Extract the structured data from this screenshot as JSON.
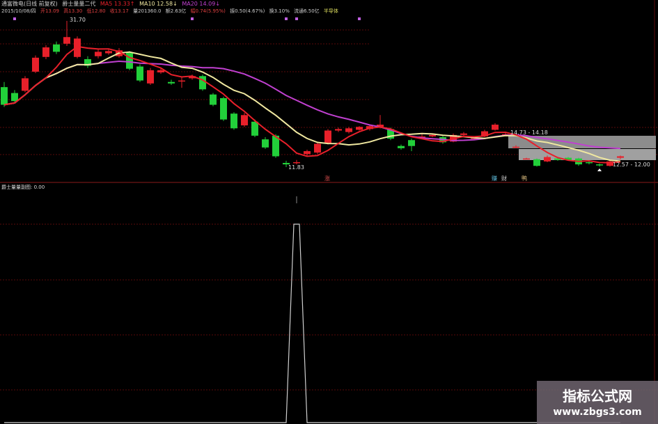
{
  "header": {
    "title": "通富微电(日线 前复权)",
    "indicator": "爵士量量二代",
    "ma5": "MA5 13.33↑",
    "ma10": "MA10 12.58↓",
    "ma20": "MA20 14.09↓",
    "date": "2015/10/08/四",
    "open": "开13.09",
    "high": "高13.30",
    "low": "低12.80",
    "close": "收13.17",
    "volume": "量201360.0",
    "amount": "额2.63亿",
    "change": "幅0.74(5.95%)",
    "amplitude": "振0.50(4.67%)",
    "turnover": "换3.10%",
    "float": "流通6.50亿",
    "sector": "半导体"
  },
  "colors": {
    "up": "#e8202a",
    "down": "#22d03a",
    "ma5": "#e8202a",
    "ma10": "#f0e8a0",
    "ma20": "#c040d0",
    "grid": "#5a0a0a",
    "signal": "#d0d0d0",
    "marker": "#c060e0"
  },
  "price_labels": {
    "high": "31.70",
    "low": "11.83",
    "zone_upper": "14.73 - 14.18",
    "zone_lower": "12.57 - 12.00"
  },
  "signal_tags": [
    {
      "text": "涨",
      "color": "#e05050"
    },
    {
      "text": "赚",
      "color": "#60c0e0"
    },
    {
      "text": "财",
      "color": "#d0d0d0"
    },
    {
      "text": "鸭",
      "color": "#e0c080"
    }
  ],
  "sub_panel": {
    "label": "爵士量量副图: 0.00"
  },
  "watermark": {
    "title": "指标公式网",
    "url": "www.zbgs3.com"
  },
  "candles": [
    [
      22.7,
      23.4,
      20.0,
      20.3
    ],
    [
      21.9,
      22.3,
      20.5,
      20.8
    ],
    [
      22.2,
      24.2,
      22.0,
      23.9
    ],
    [
      24.8,
      27.0,
      24.6,
      26.7
    ],
    [
      26.8,
      28.4,
      26.5,
      28.1
    ],
    [
      28.5,
      28.9,
      27.2,
      27.5
    ],
    [
      28.6,
      31.7,
      28.3,
      29.5
    ],
    [
      26.8,
      29.6,
      26.6,
      29.3
    ],
    [
      26.5,
      26.9,
      25.3,
      25.6
    ],
    [
      26.9,
      27.8,
      26.6,
      27.5
    ],
    [
      27.3,
      27.9,
      27.1,
      27.6
    ],
    [
      26.9,
      28.0,
      26.7,
      27.7
    ],
    [
      27.4,
      27.6,
      25.0,
      25.2
    ],
    [
      25.5,
      25.8,
      23.4,
      23.6
    ],
    [
      23.2,
      25.3,
      23.0,
      25.0
    ],
    [
      24.7,
      25.3,
      24.5,
      25.0
    ],
    [
      23.4,
      23.7,
      23.0,
      23.2
    ],
    [
      23.6,
      24.1,
      22.6,
      23.6
    ],
    [
      23.9,
      24.4,
      23.7,
      24.2
    ],
    [
      24.2,
      24.4,
      22.2,
      22.4
    ],
    [
      21.7,
      21.9,
      20.1,
      20.3
    ],
    [
      21.2,
      21.4,
      18.1,
      18.3
    ],
    [
      19.1,
      19.3,
      16.9,
      17.1
    ],
    [
      17.5,
      19.2,
      17.3,
      18.9
    ],
    [
      18.0,
      18.3,
      15.9,
      16.1
    ],
    [
      15.6,
      15.9,
      14.3,
      14.5
    ],
    [
      16.1,
      16.3,
      13.1,
      13.3
    ],
    [
      12.4,
      12.7,
      11.83,
      12.2
    ],
    [
      12.5,
      12.8,
      12.2,
      12.5
    ],
    [
      13.6,
      14.2,
      13.4,
      14.0
    ],
    [
      13.8,
      15.2,
      13.6,
      15.0
    ],
    [
      15.1,
      17.0,
      14.9,
      16.8
    ],
    [
      16.8,
      17.2,
      16.6,
      17.0
    ],
    [
      16.6,
      17.3,
      16.4,
      17.1
    ],
    [
      16.9,
      17.4,
      16.8,
      17.3
    ],
    [
      17.0,
      17.5,
      16.8,
      17.4
    ],
    [
      17.3,
      18.9,
      17.1,
      17.6
    ],
    [
      17.0,
      17.2,
      15.5,
      15.7
    ],
    [
      14.7,
      14.9,
      14.2,
      14.4
    ],
    [
      15.5,
      15.7,
      14.0,
      14.7
    ],
    [
      16.0,
      16.3,
      15.8,
      16.0
    ],
    [
      16.0,
      16.4,
      15.9,
      16.2
    ],
    [
      15.9,
      16.1,
      15.0,
      15.2
    ],
    [
      15.3,
      16.4,
      15.2,
      16.2
    ],
    [
      16.2,
      16.6,
      16.0,
      16.4
    ],
    [
      15.8,
      16.0,
      15.6,
      15.8
    ],
    [
      16.0,
      16.9,
      15.9,
      16.7
    ],
    [
      16.9,
      17.8,
      16.8,
      17.6
    ],
    [
      16.3,
      16.5,
      16.1,
      16.3
    ],
    [
      14.6,
      14.8,
      14.4,
      14.6
    ],
    [
      13.0,
      13.1,
      12.9,
      13.0
    ],
    [
      12.9,
      13.0,
      11.9,
      12.0
    ],
    [
      12.6,
      13.4,
      12.5,
      13.2
    ],
    [
      13.0,
      13.1,
      12.7,
      12.8
    ],
    [
      13.1,
      13.2,
      12.7,
      12.8
    ],
    [
      13.0,
      13.1,
      12.0,
      12.2
    ],
    [
      12.5,
      12.6,
      12.2,
      12.4
    ],
    [
      12.2,
      12.3,
      11.9,
      12.1
    ],
    [
      12.0,
      12.8,
      11.9,
      12.6
    ],
    [
      13.1,
      13.4,
      12.9,
      13.3
    ]
  ],
  "signal_values": [
    0,
    0,
    0,
    0,
    0,
    0,
    0,
    0,
    0,
    0,
    0,
    0,
    0,
    0,
    0,
    0,
    0,
    0,
    0,
    0,
    0,
    0,
    0,
    0,
    0,
    0,
    0,
    0,
    1,
    0,
    0,
    0,
    0,
    0,
    0,
    0,
    0,
    0,
    0,
    0,
    0,
    0,
    0,
    0,
    0,
    0,
    0,
    0,
    0,
    0,
    0,
    0,
    0,
    0,
    0,
    0,
    0,
    0,
    0,
    0
  ],
  "marker_indices": [
    1,
    18,
    27,
    28,
    34
  ]
}
